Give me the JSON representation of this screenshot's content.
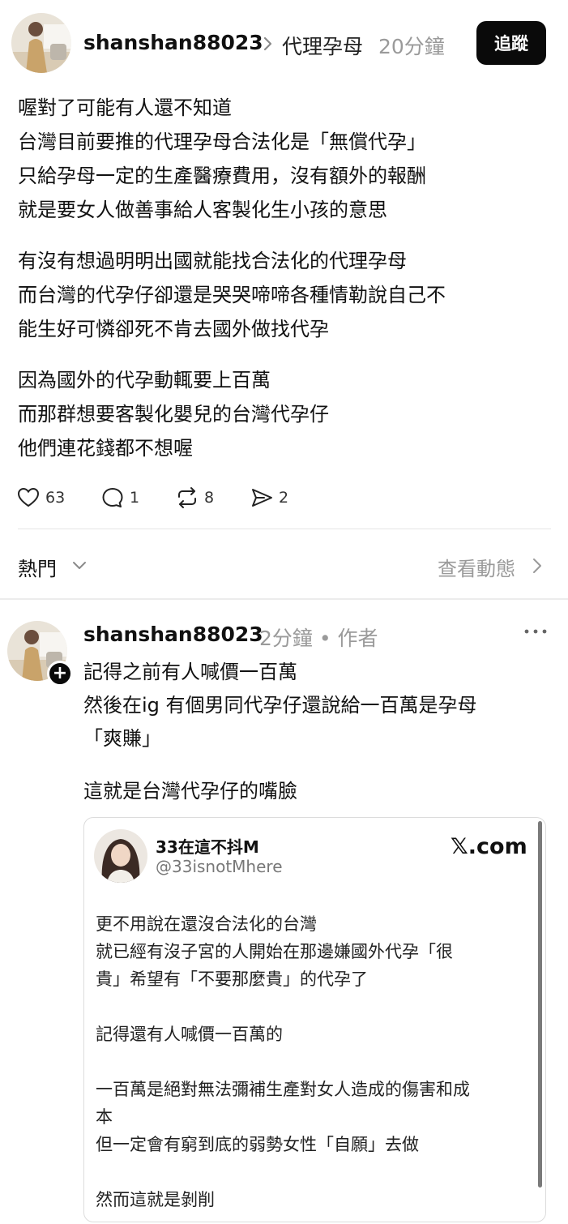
{
  "post": {
    "username": "shanshan88023",
    "topic": "代理孕母",
    "time": "20分鐘",
    "follow_label": "追蹤",
    "paragraphs": [
      [
        "喔對了可能有人還不知道",
        "台灣目前要推的代理孕母合法化是「無償代孕」",
        "只給孕母一定的生產醫療費用，沒有額外的報酬",
        "就是要女人做善事給人客製化生小孩的意思"
      ],
      [
        "有沒有想過明明出國就能找合法化的代理孕母",
        "而台灣的代孕仔卻還是哭哭啼啼各種情勒說自己不",
        "能生好可憐卻死不肯去國外做找代孕"
      ],
      [
        "因為國外的代孕動輒要上百萬",
        "而那群想要客製化嬰兒的台灣代孕仔",
        "他們連花錢都不想喔"
      ]
    ],
    "actions": {
      "likes": "63",
      "comments": "1",
      "reposts": "8",
      "shares": "2"
    },
    "icons": [
      "heart-icon",
      "comment-icon",
      "repost-icon",
      "share-icon"
    ]
  },
  "sort": {
    "label": "熱門",
    "view_activity": "查看動態"
  },
  "reply": {
    "username": "shanshan88023",
    "meta": "2分鐘 • 作者",
    "paragraphs": [
      [
        "記得之前有人喊價一百萬",
        "然後在ig 有個男同代孕仔還說給一百萬是孕母",
        "「爽賺」"
      ],
      [
        "這就是台灣代孕仔的嘴臉"
      ]
    ],
    "embed": {
      "name": "33在這不抖M",
      "handle": "@33isnotMhere",
      "brand": "𝕏.com",
      "lines": [
        "更不用說在還沒合法化的台灣",
        "就已經有沒子宮的人開始在那邊嫌國外代孕「很",
        "貴」希望有「不要那麼貴」的代孕了",
        "",
        "記得還有人喊價一百萬的",
        "",
        "一百萬是絕對無法彌補生產對女人造成的傷害和成",
        "本",
        "但一定會有窮到底的弱勢女性「自願」去做",
        "",
        "然而這就是剝削"
      ]
    }
  },
  "colors": {
    "text": "#111111",
    "muted": "#9a9a9a",
    "button_bg": "#0a0a0a",
    "divider": "#e6e6e6"
  }
}
